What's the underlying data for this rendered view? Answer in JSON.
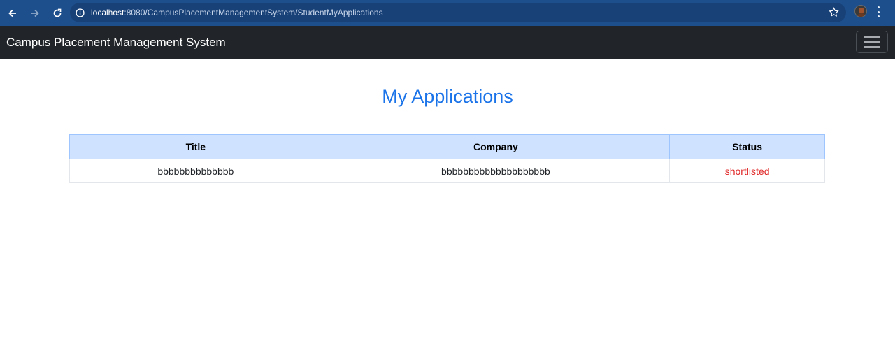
{
  "browser": {
    "url_host": "localhost",
    "url_rest": ":8080/CampusPlacementManagementSystem/StudentMyApplications"
  },
  "navbar": {
    "brand": "Campus Placement Management System"
  },
  "page": {
    "heading": "My Applications"
  },
  "table": {
    "headers": [
      "Title",
      "Company",
      "Status"
    ],
    "rows": [
      {
        "title": "bbbbbbbbbbbbbb",
        "company": "bbbbbbbbbbbbbbbbbbbb",
        "status": "shortlisted"
      }
    ]
  },
  "colors": {
    "browser_bar": "#1d4f8c",
    "navbar": "#212529",
    "heading": "#1a73e8",
    "table_header": "#cfe2ff",
    "status_text": "#e02424"
  }
}
